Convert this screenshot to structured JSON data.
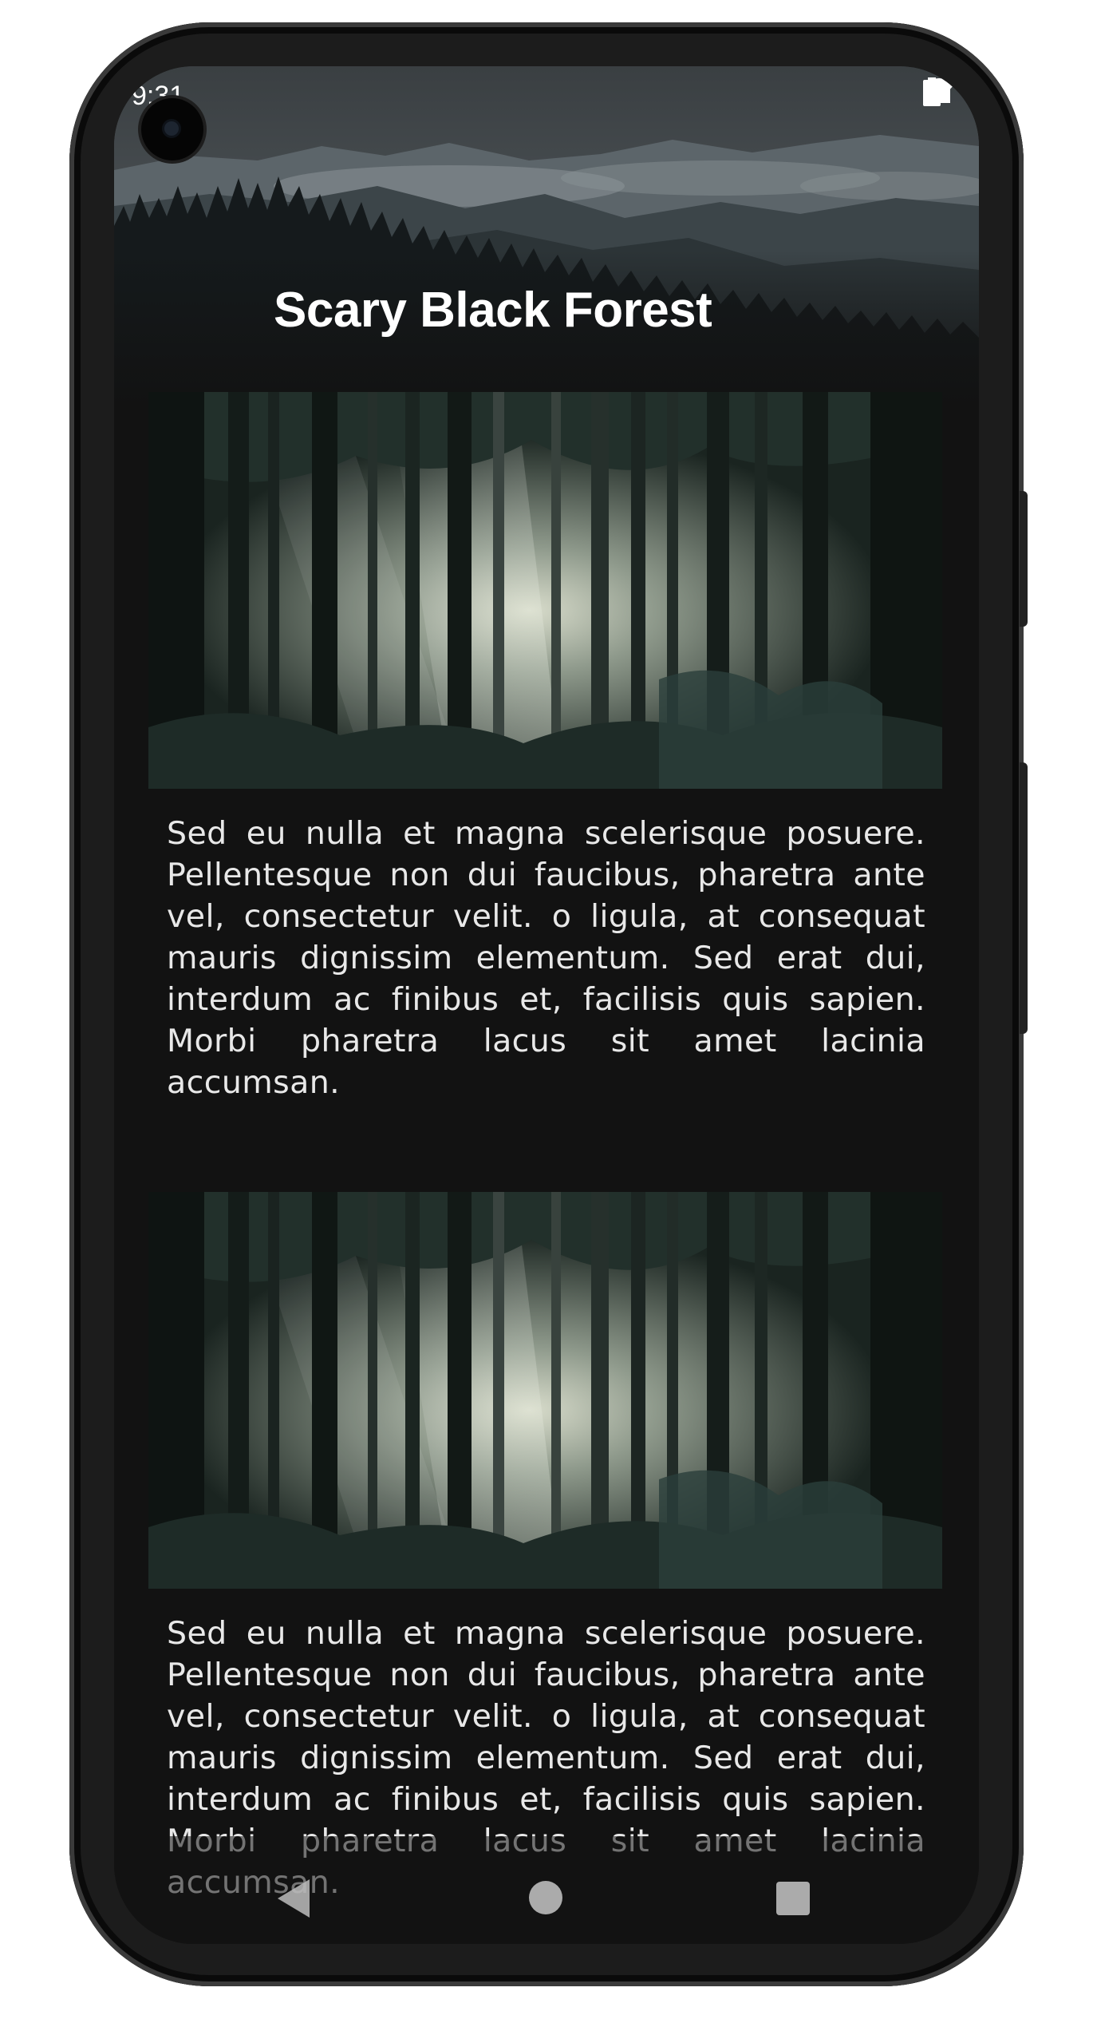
{
  "status_bar": {
    "time": "9:31",
    "icons": [
      "notification-icon",
      "wifi-icon",
      "signal-icon",
      "battery-icon"
    ]
  },
  "toolbar": {
    "title": "Scary Black Forest",
    "header_image": "misty-mountain-forest"
  },
  "cards": [
    {
      "image": "forest-sunrays-photo",
      "text": "Sed eu nulla et magna scelerisque posuere. Pellentesque non dui faucibus, pharetra ante vel, consectetur velit. o ligula, at consequat mauris dignissim elementum. Sed erat dui, interdum ac finibus et, facilisis quis sapien. Morbi pharetra lacus sit amet lacinia accumsan."
    },
    {
      "image": "forest-sunrays-photo",
      "text": "Sed eu nulla et magna scelerisque posuere. Pellentesque non dui faucibus, pharetra ante vel, consectetur velit. o ligula, at consequat mauris dignissim elementum. Sed erat dui, interdum ac finibus et, facilisis quis sapien. Morbi pharetra lacus sit amet lacinia accumsan."
    }
  ],
  "nav_bar": {
    "buttons": [
      "back-icon",
      "home-icon",
      "recents-icon"
    ]
  },
  "colors": {
    "background": "#121212",
    "text": "#e8e8e8",
    "title": "#ffffff"
  }
}
